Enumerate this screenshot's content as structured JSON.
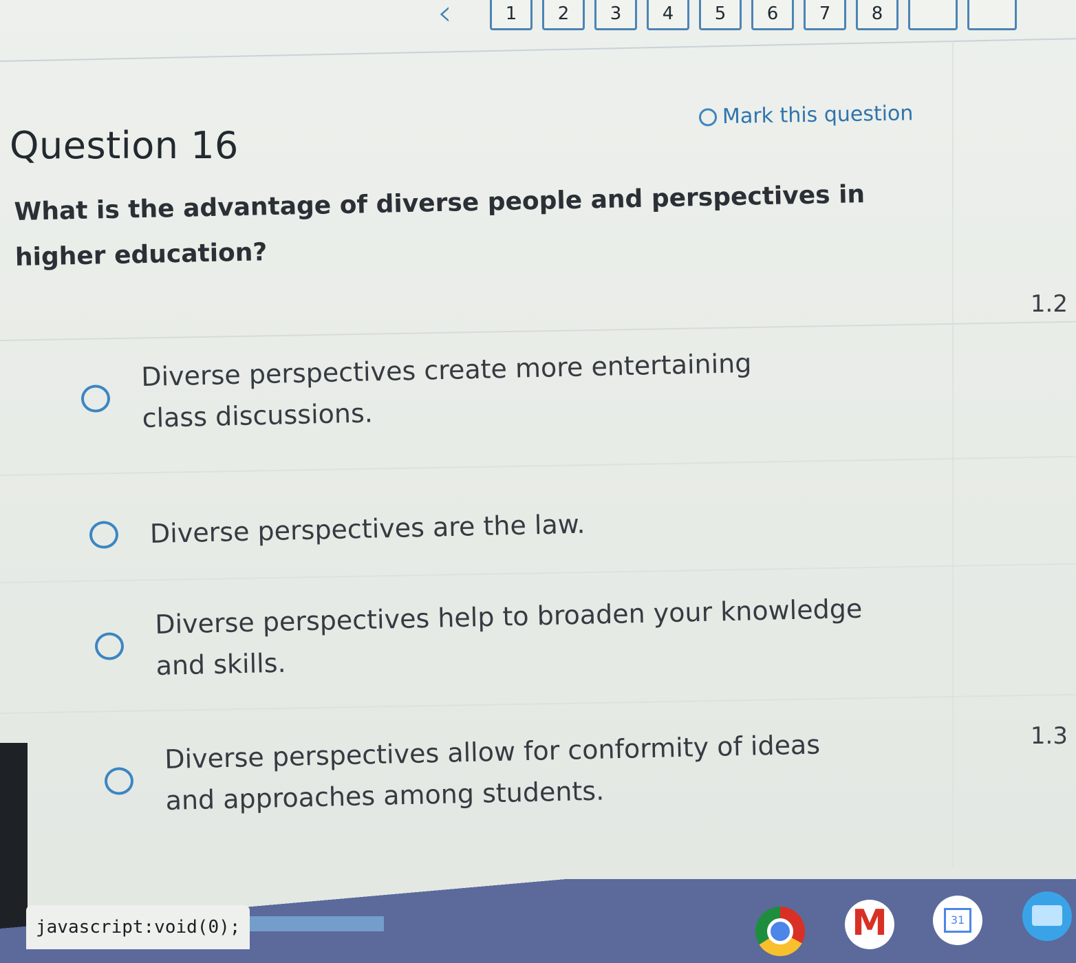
{
  "pagination": {
    "prev_icon": "chevron-left-icon",
    "pages": [
      "1",
      "2",
      "3",
      "4",
      "5",
      "6",
      "7",
      "8",
      "",
      "",
      ""
    ]
  },
  "question": {
    "title": "Question 16",
    "mark_label": "Mark this question",
    "text": "What is the advantage of diverse people and perspectives in higher education?"
  },
  "side_numbers": {
    "first": "1.2",
    "second": "1.3"
  },
  "options": [
    {
      "label": "Diverse perspectives create more entertaining class discussions."
    },
    {
      "label": "Diverse perspectives are the law."
    },
    {
      "label": "Diverse perspectives help to broaden your knowledge and skills."
    },
    {
      "label": "Diverse perspectives allow for conformity of ideas and approaches among students."
    }
  ],
  "status_bar": {
    "url": "javascript:void(0);"
  },
  "taskbar": {
    "apps": [
      "chrome-icon",
      "gmail-icon",
      "calendar-icon",
      "files-icon"
    ]
  },
  "colors": {
    "accent": "#3c86c2",
    "text": "#353b41"
  }
}
